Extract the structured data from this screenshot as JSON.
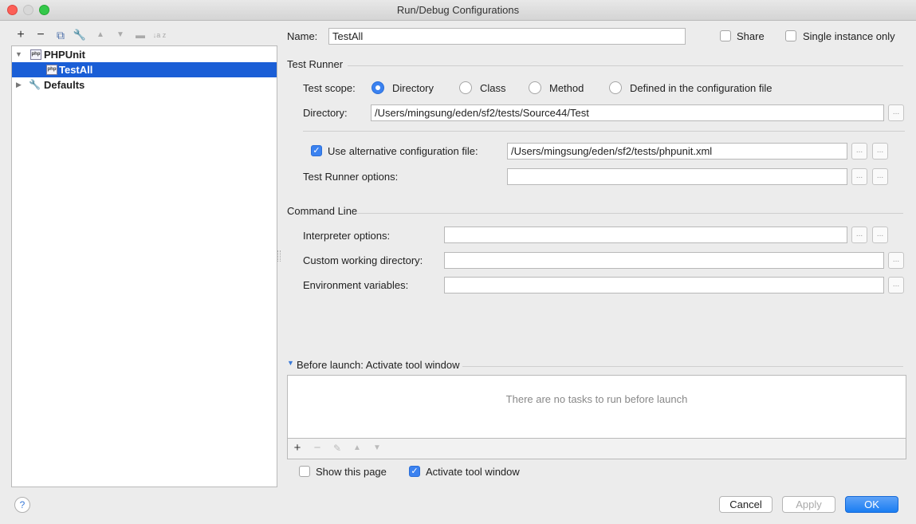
{
  "window": {
    "title": "Run/Debug Configurations"
  },
  "toolbar": {
    "add": "+",
    "remove": "−",
    "copy": "⧉",
    "edit_defaults": "🔧",
    "move_up": "▲",
    "move_down": "▼",
    "folder": "▬",
    "sort": "↓a z"
  },
  "tree": {
    "group_label": "PHPUnit",
    "item_label": "TestAll",
    "defaults_label": "Defaults",
    "icon_text": "php"
  },
  "name": {
    "label": "Name:",
    "value": "TestAll"
  },
  "share": {
    "label": "Share",
    "checked": false
  },
  "single_instance": {
    "label": "Single instance only",
    "checked": false
  },
  "test_runner": {
    "section_title": "Test Runner",
    "scope_label": "Test scope:",
    "scope_options": [
      "Directory",
      "Class",
      "Method",
      "Defined in the configuration file"
    ],
    "scope_selected": "Directory",
    "directory_label": "Directory:",
    "directory_value": "/Users/mingsung/eden/sf2/tests/Source44/Test",
    "alt_config_label": "Use alternative configuration file:",
    "alt_config_checked": true,
    "alt_config_value": "/Users/mingsung/eden/sf2/tests/phpunit.xml",
    "runner_options_label": "Test Runner options:",
    "runner_options_value": ""
  },
  "command_line": {
    "section_title": "Command Line",
    "interpreter_label": "Interpreter options:",
    "interpreter_value": "",
    "working_dir_label": "Custom working directory:",
    "working_dir_value": "",
    "env_label": "Environment variables:",
    "env_value": ""
  },
  "before_launch": {
    "title": "Before launch: Activate tool window",
    "empty_text": "There are no tasks to run before launch",
    "add": "+",
    "remove": "−",
    "edit": "✎",
    "up": "▲",
    "down": "▼"
  },
  "show_page": {
    "label": "Show this page",
    "checked": false
  },
  "activate_tool": {
    "label": "Activate tool window",
    "checked": true
  },
  "buttons": {
    "help": "?",
    "cancel": "Cancel",
    "apply": "Apply",
    "ok": "OK"
  },
  "dots": "..."
}
